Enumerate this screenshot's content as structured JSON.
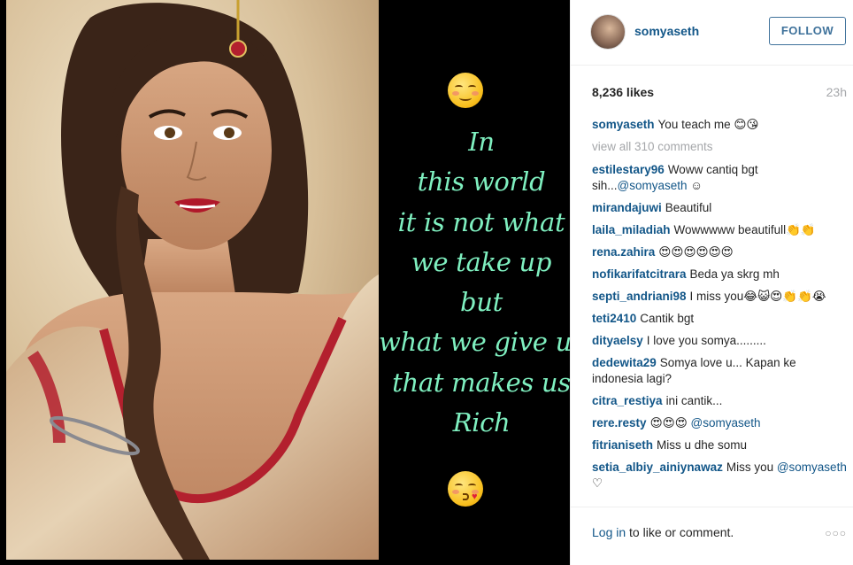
{
  "post": {
    "quote": {
      "lines": [
        "In",
        "this world",
        "it is not what",
        "we take up",
        "but",
        "what we give up,",
        "that makes us",
        "Rich"
      ]
    },
    "author": {
      "username": "somyaseth",
      "avatar": "profile-photo"
    },
    "follow_label": "FOLLOW",
    "likes": "8,236 likes",
    "time_ago": "23h",
    "caption": {
      "user": "somyaseth",
      "text": "You teach me 😊😘"
    },
    "view_all": "view all 310 comments",
    "comments": [
      {
        "user": "estilestary96",
        "text": "Woww cantiq bgt sih...",
        "mention": "@somyaseth",
        "after": " ☺"
      },
      {
        "user": "mirandajuwi",
        "text": "Beautiful"
      },
      {
        "user": "laila_miladiah",
        "text": "Wowwwww beautifull👏👏"
      },
      {
        "user": "rena.zahira",
        "text": "😍😍😍😍😍😍"
      },
      {
        "user": "nofikarifatcitrara",
        "text": "Beda ya skrg mh"
      },
      {
        "user": "septi_andriani98",
        "text": "I miss you😂😺😍👏👏😭"
      },
      {
        "user": "teti2410",
        "text": "Cantik bgt"
      },
      {
        "user": "dityaelsy",
        "text": "I love you somya........."
      },
      {
        "user": "dedewita29",
        "text": "Somya love u... Kapan ke indonesia lagi?"
      },
      {
        "user": "citra_restiya",
        "text": "ini cantik..."
      },
      {
        "user": "rere.resty",
        "text": "😍😍😍 ",
        "mention": "@somyaseth"
      },
      {
        "user": "fitrianiseth",
        "text": "Miss u dhe somu"
      },
      {
        "user": "setia_albiy_ainiynawaz",
        "text": "Miss you ",
        "mention": "@somyaseth",
        "after": " ♡"
      }
    ],
    "footer": {
      "login_link": "Log in",
      "login_rest": " to like or comment.",
      "more": "○○○"
    }
  },
  "colors": {
    "link": "#125688",
    "follow": "#3f729b",
    "quote_text": "#7ff0c0",
    "muted": "#a5a7aa"
  },
  "icons": [
    "avatar",
    "smiling-face-emoji-icon",
    "kissing-face-emoji-icon",
    "more-options-icon"
  ]
}
